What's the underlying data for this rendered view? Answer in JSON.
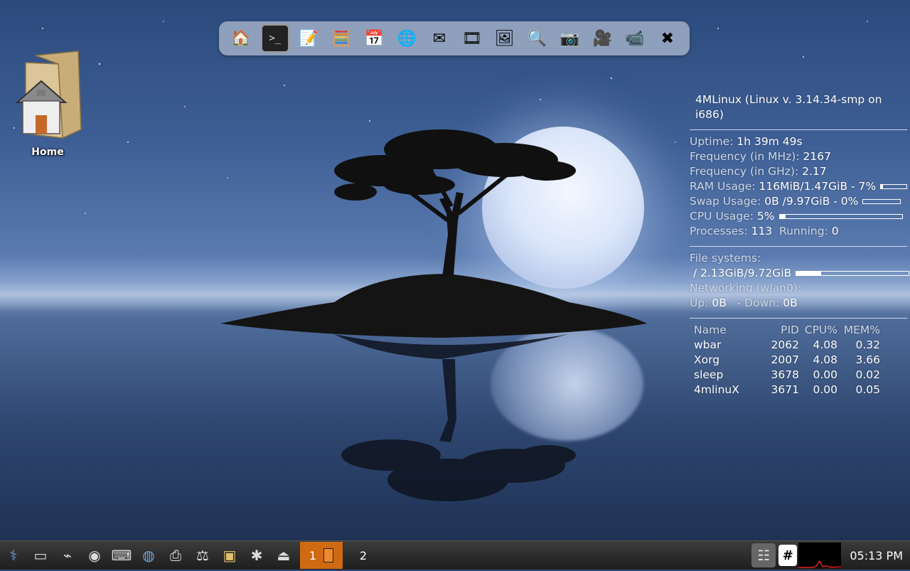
{
  "desktop": {
    "home_icon_label": "Home"
  },
  "launcher": {
    "items": [
      {
        "name": "home-folder-icon",
        "glyph": "🏠"
      },
      {
        "name": "terminal-icon",
        "glyph": ">_"
      },
      {
        "name": "text-editor-icon",
        "glyph": "📝"
      },
      {
        "name": "calculator-icon",
        "glyph": "🧮"
      },
      {
        "name": "calendar-icon",
        "glyph": "📅"
      },
      {
        "name": "web-browser-icon",
        "glyph": "🌐"
      },
      {
        "name": "mail-icon",
        "glyph": "✉"
      },
      {
        "name": "media-player-icon",
        "glyph": "🎞"
      },
      {
        "name": "image-viewer-icon",
        "glyph": "🖼"
      },
      {
        "name": "search-icon",
        "glyph": "🔍"
      },
      {
        "name": "camera-icon",
        "glyph": "📷"
      },
      {
        "name": "video-camera-icon",
        "glyph": "🎥"
      },
      {
        "name": "webcam-icon",
        "glyph": "📹"
      },
      {
        "name": "close-x-icon",
        "glyph": "✖"
      }
    ]
  },
  "conky": {
    "header": "4MLinux (Linux v. 3.14.34-smp on i686)",
    "uptime_label": "Uptime:",
    "uptime_value": "1h 39m 49s",
    "freq_mhz_label": "Frequency (in MHz):",
    "freq_mhz_value": "2167",
    "freq_ghz_label": "Frequency (in GHz):",
    "freq_ghz_value": "2.17",
    "ram_label": "RAM Usage:",
    "ram_value": "116MiB/1.47GiB - 7%",
    "ram_fraction": 0.07,
    "swap_label": "Swap Usage:",
    "swap_value": "0B  /9.97GiB - 0%",
    "swap_fraction": 0.0,
    "cpu_label": "CPU Usage:",
    "cpu_value": "5%",
    "cpu_fraction": 0.05,
    "proc_label": "Processes:",
    "proc_value": "113",
    "running_label": "Running:",
    "running_value": "0",
    "fs_label": "File systems:",
    "fs_value": "/ 2.13GiB/9.72GiB",
    "fs_fraction": 0.22,
    "net_label": "Networking (wlan0):",
    "up_label": "Up:",
    "up_value": "0B",
    "down_label": "- Down:",
    "down_value": "0B",
    "table_headers": {
      "name": "Name",
      "pid": "PID",
      "cpu": "CPU%",
      "mem": "MEM%"
    },
    "processes": [
      {
        "name": "wbar",
        "pid": "2062",
        "cpu": "4.08",
        "mem": "0.32"
      },
      {
        "name": "Xorg",
        "pid": "2007",
        "cpu": "4.08",
        "mem": "3.66"
      },
      {
        "name": "sleep",
        "pid": "3678",
        "cpu": "0.00",
        "mem": "0.02"
      },
      {
        "name": "4mlinuX",
        "pid": "3671",
        "cpu": "0.00",
        "mem": "0.05"
      }
    ]
  },
  "taskbar": {
    "desktop_1": "1",
    "desktop_2": "2",
    "clock": "05:13 PM",
    "tray_hash": "#"
  }
}
